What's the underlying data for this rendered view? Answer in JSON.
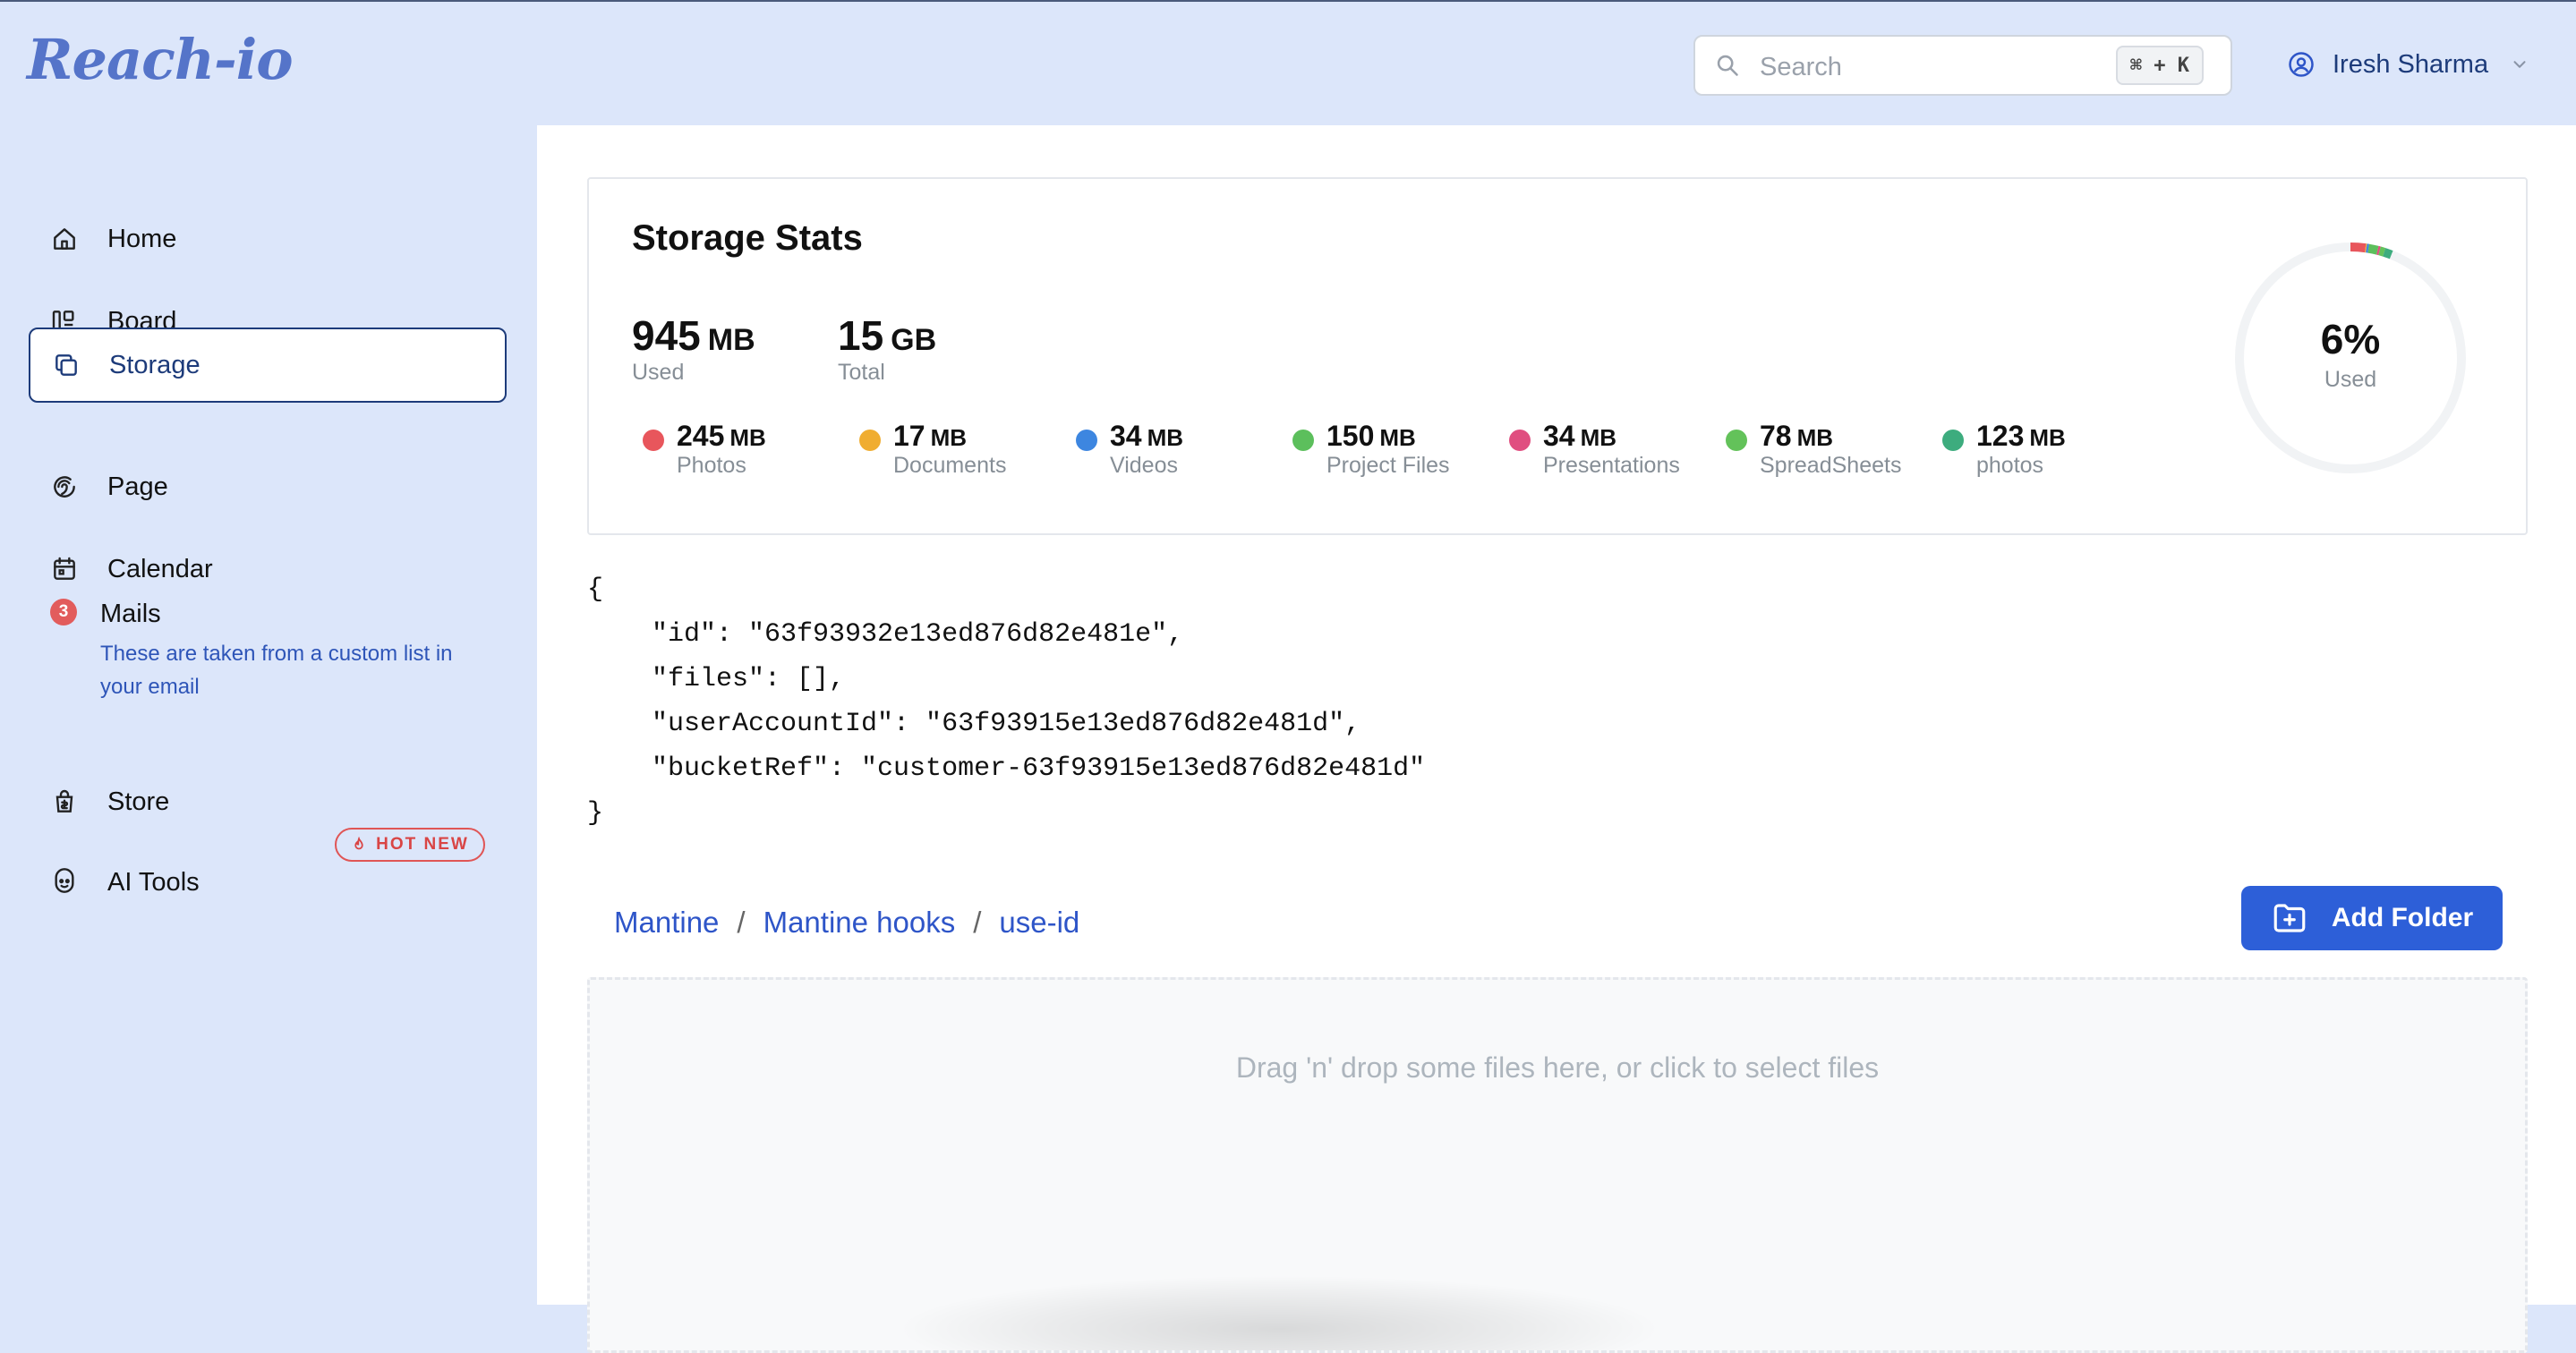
{
  "app": {
    "logo": "Reach-io"
  },
  "header": {
    "search_placeholder": "Search",
    "search_shortcut": "⌘ + K",
    "user_name": "Iresh Sharma"
  },
  "sidebar": {
    "items": [
      {
        "label": "Home",
        "icon": "home-icon"
      },
      {
        "label": "Board",
        "icon": "board-icon"
      },
      {
        "label": "Storage",
        "icon": "copy-icon",
        "active": true
      },
      {
        "label": "Page",
        "icon": "page-icon"
      },
      {
        "label": "Calendar",
        "icon": "calendar-icon"
      },
      {
        "label": "Mails",
        "badge": "3",
        "description": "These are taken from a custom list in your email"
      },
      {
        "label": "Store",
        "icon": "store-icon"
      },
      {
        "label": "AI Tools",
        "icon": "ai-icon",
        "badge": "HOT NEW"
      }
    ]
  },
  "storage": {
    "title": "Storage Stats",
    "used": {
      "value": "945",
      "unit": "MB",
      "label": "Used"
    },
    "total": {
      "value": "15",
      "unit": "GB",
      "label": "Total"
    },
    "percent_used": 6,
    "percent_text": "6%",
    "percent_label": "Used",
    "categories": [
      {
        "value": "245",
        "unit": "MB",
        "label": "Photos",
        "color": "#e8565c"
      },
      {
        "value": "17",
        "unit": "MB",
        "label": "Documents",
        "color": "#f0ad31"
      },
      {
        "value": "34",
        "unit": "MB",
        "label": "Videos",
        "color": "#3d86e0"
      },
      {
        "value": "150",
        "unit": "MB",
        "label": "Project Files",
        "color": "#5cbf5c"
      },
      {
        "value": "34",
        "unit": "MB",
        "label": "Presentations",
        "color": "#e04e80"
      },
      {
        "value": "78",
        "unit": "MB",
        "label": "SpreadSheets",
        "color": "#63c25a"
      },
      {
        "value": "123",
        "unit": "MB",
        "label": "photos",
        "color": "#3dac7e"
      }
    ]
  },
  "json_dump": "{\n    \"id\": \"63f93932e13ed876d82e481e\",\n    \"files\": [],\n    \"userAccountId\": \"63f93915e13ed876d82e481d\",\n    \"bucketRef\": \"customer-63f93915e13ed876d82e481d\"\n}",
  "breadcrumb": {
    "items": [
      "Mantine",
      "Mantine hooks",
      "use-id"
    ],
    "separator": "/"
  },
  "add_folder_label": "Add Folder",
  "dropzone_text": "Drag 'n' drop some files here, or click to select files"
}
